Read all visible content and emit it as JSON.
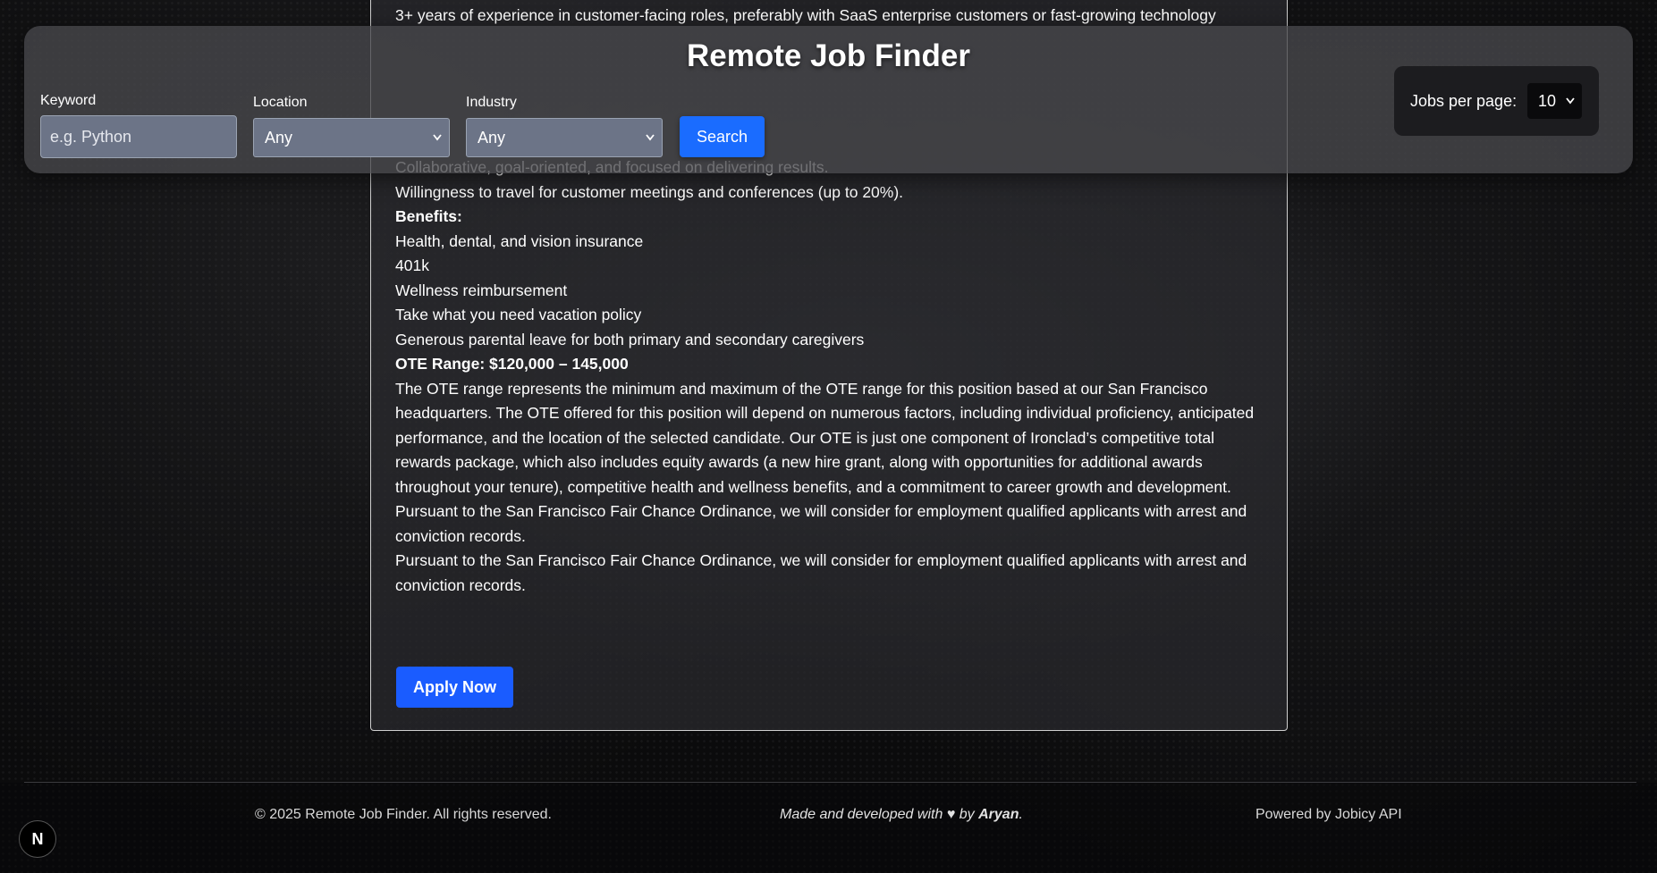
{
  "job": {
    "top_line": "3+ years of experience in customer-facing roles, preferably with SaaS enterprise customers or fast-growing technology",
    "lines": [
      "Collaborative, goal-oriented, and focused on delivering results.",
      "Willingness to travel for customer meetings and conferences (up to 20%)."
    ],
    "benefits_heading": "Benefits:",
    "benefits": [
      "Health, dental, and vision insurance",
      "401k",
      "Wellness reimbursement",
      "Take what you need vacation policy",
      "Generous parental leave for both primary and secondary caregivers"
    ],
    "ote_heading": "OTE Range: $120,000 – 145,000",
    "ote_paragraph": "The OTE range represents the minimum and maximum of the OTE range for this position based at our San Francisco headquarters. The OTE offered for this position will depend on numerous factors, including individual proficiency, anticipated performance, and the location of the selected candidate. Our OTE is just one component of Ironclad’s competitive total rewards package, which also includes equity awards (a new hire grant, along with opportunities for additional awards throughout your tenure), competitive health and wellness benefits, and a commitment to career growth and development.",
    "fair_chance_1": "Pursuant to the San Francisco Fair Chance Ordinance, we will consider for employment qualified applicants with arrest and conviction records.",
    "fair_chance_2": "Pursuant to the San Francisco Fair Chance Ordinance, we will consider for employment qualified applicants with arrest and conviction records.",
    "apply_label": "Apply Now"
  },
  "header": {
    "title": "Remote Job Finder",
    "keyword_label": "Keyword",
    "keyword_placeholder": "e.g. Python",
    "location_label": "Location",
    "location_value": "Any",
    "industry_label": "Industry",
    "industry_value": "Any",
    "search_label": "Search",
    "per_page_label": "Jobs per page:",
    "per_page_value": "10"
  },
  "footer": {
    "copyright": "© 2025 Remote Job Finder. All rights reserved.",
    "made_prefix": "Made and developed with",
    "made_heart": "♥",
    "made_by": "by",
    "made_author": "Aryan",
    "made_suffix": ".",
    "powered": "Powered by Jobicy API"
  },
  "badge": {
    "letter": "N"
  },
  "colors": {
    "accent": "#1a5cff"
  }
}
